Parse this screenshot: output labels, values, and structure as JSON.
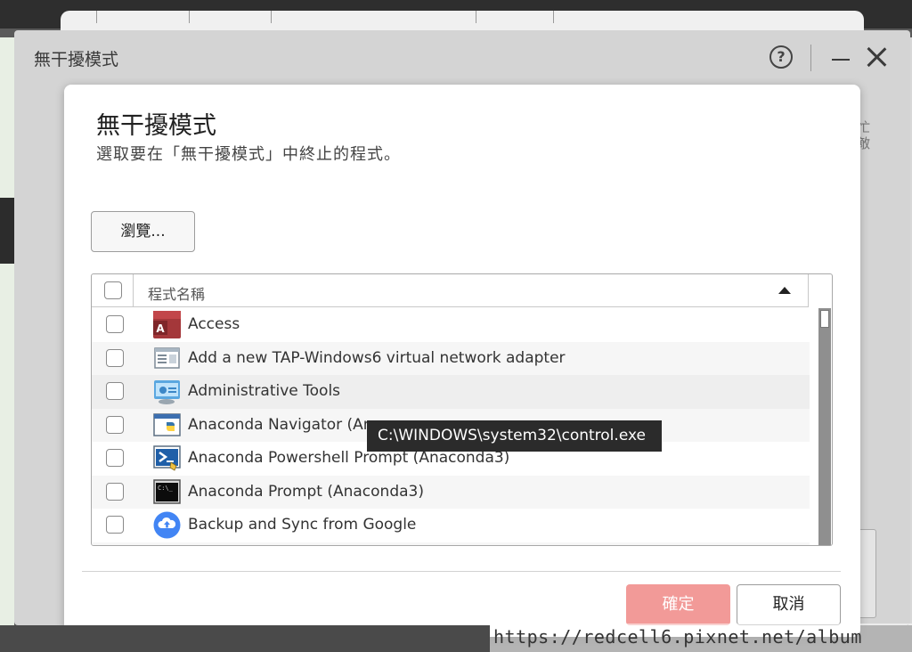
{
  "window": {
    "title": "無干擾模式",
    "help_label": "?",
    "side_text": "忙 敵"
  },
  "dialog": {
    "title": "無干擾模式",
    "subtitle": "選取要在「無干擾模式」中終止的程式。",
    "browse_label": "瀏覽...",
    "column_header": "程式名稱",
    "rows": [
      {
        "name": "Access",
        "icon": "access-icon"
      },
      {
        "name": "Add a new TAP-Windows6 virtual network adapter",
        "icon": "network-adapter-icon"
      },
      {
        "name": "Administrative Tools",
        "icon": "admin-tools-icon"
      },
      {
        "name": "Anaconda Navigator (Ana",
        "icon": "anaconda-navigator-icon"
      },
      {
        "name": "Anaconda Powershell Prompt (Anaconda3)",
        "icon": "powershell-icon"
      },
      {
        "name": "Anaconda Prompt (Anaconda3)",
        "icon": "command-prompt-icon"
      },
      {
        "name": "Backup and Sync from Google",
        "icon": "cloud-upload-icon"
      }
    ],
    "tooltip": "C:\\WINDOWS\\system32\\control.exe",
    "ok_label": "確定",
    "cancel_label": "取消"
  },
  "colors": {
    "ok_button": "#f29a98",
    "access_red": "#a4373a",
    "google_blue": "#4285f4"
  },
  "watermark": "https://redcell6.pixnet.net/album"
}
